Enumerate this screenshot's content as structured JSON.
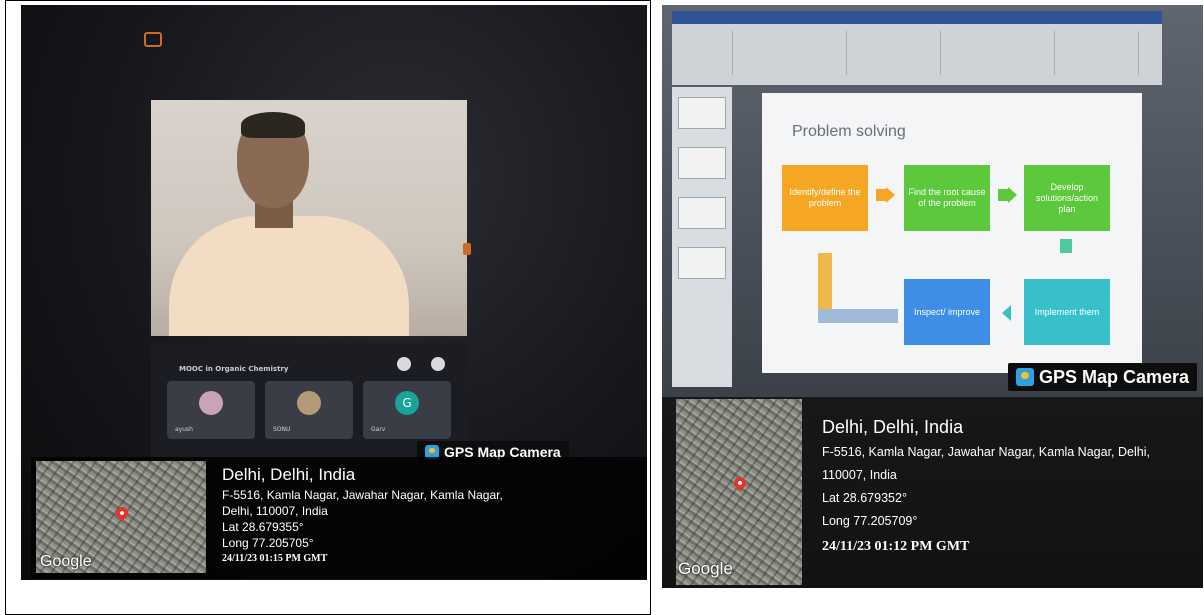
{
  "left_photo": {
    "course_title": "MOOC in Organic Chemistry",
    "participants": [
      {
        "name": "ayush",
        "letter": ""
      },
      {
        "name": "SONU",
        "letter": ""
      },
      {
        "name": "Garv",
        "letter": "G"
      }
    ],
    "gps": {
      "badge": "GPS Map Camera",
      "city": "Delhi, Delhi, India",
      "address_line1": "F-5516, Kamla Nagar, Jawahar Nagar, Kamla Nagar,",
      "address_line2": "Delhi, 110007, India",
      "lat": "Lat 28.679355°",
      "long": "Long 77.205705°",
      "timestamp": "24/11/23 01:15 PM GMT",
      "map_logo": "Google"
    }
  },
  "right_photo": {
    "slide": {
      "title": "Problem solving",
      "steps": [
        "Identify/define the problem",
        "Find the root cause of the problem",
        "Develop solutions/action plan",
        "Implement them",
        "Inspect/ improve"
      ]
    },
    "gps": {
      "badge": "GPS Map Camera",
      "city": "Delhi, Delhi, India",
      "address_line1": "F-5516, Kamla Nagar, Jawahar Nagar, Kamla Nagar, Delhi,",
      "address_line2": "110007, India",
      "lat": "Lat 28.679352°",
      "long": "Long 77.205709°",
      "timestamp": "24/11/23 01:12 PM GMT",
      "map_logo": "Google"
    }
  },
  "colors": {
    "step_orange": "#f5a623",
    "step_green": "#5cc83b",
    "step_teal": "#37c0c9",
    "step_blue": "#3f8ee6",
    "pin_red": "#e5322d"
  }
}
